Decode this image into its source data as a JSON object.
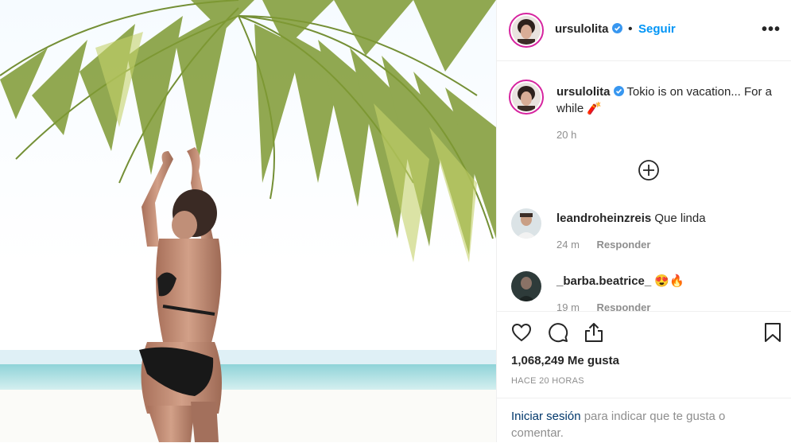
{
  "post": {
    "author": "ursulolita",
    "follow_label": "Seguir",
    "more_label": "•••",
    "caption_text": "Tokio is on vacation... For a while",
    "caption_emoji": "🧨",
    "caption_age": "20 h",
    "load_more_icon": "plus-circle-icon",
    "likes": "1,068,249 Me gusta",
    "time_ago": "HACE 20 HORAS"
  },
  "comments": [
    {
      "user": "leandroheinzreis",
      "text": "Que linda",
      "age": "24 m",
      "reply_label": "Responder"
    },
    {
      "user": "_barba.beatrice_",
      "text": "",
      "emoji": "😍🔥",
      "age": "19 m",
      "reply_label": "Responder"
    }
  ],
  "login_prompt": {
    "link": "Iniciar sesión",
    "text": " para indicar que te gusta o comentar."
  },
  "colors": {
    "accent": "#0095f6",
    "link": "#00376b",
    "muted": "#8e8e8e",
    "text": "#262626",
    "story_ring": "#d6249f"
  },
  "icons": [
    "heart-icon",
    "comment-icon",
    "share-icon",
    "bookmark-icon",
    "verified-badge-icon",
    "more-options-icon"
  ]
}
